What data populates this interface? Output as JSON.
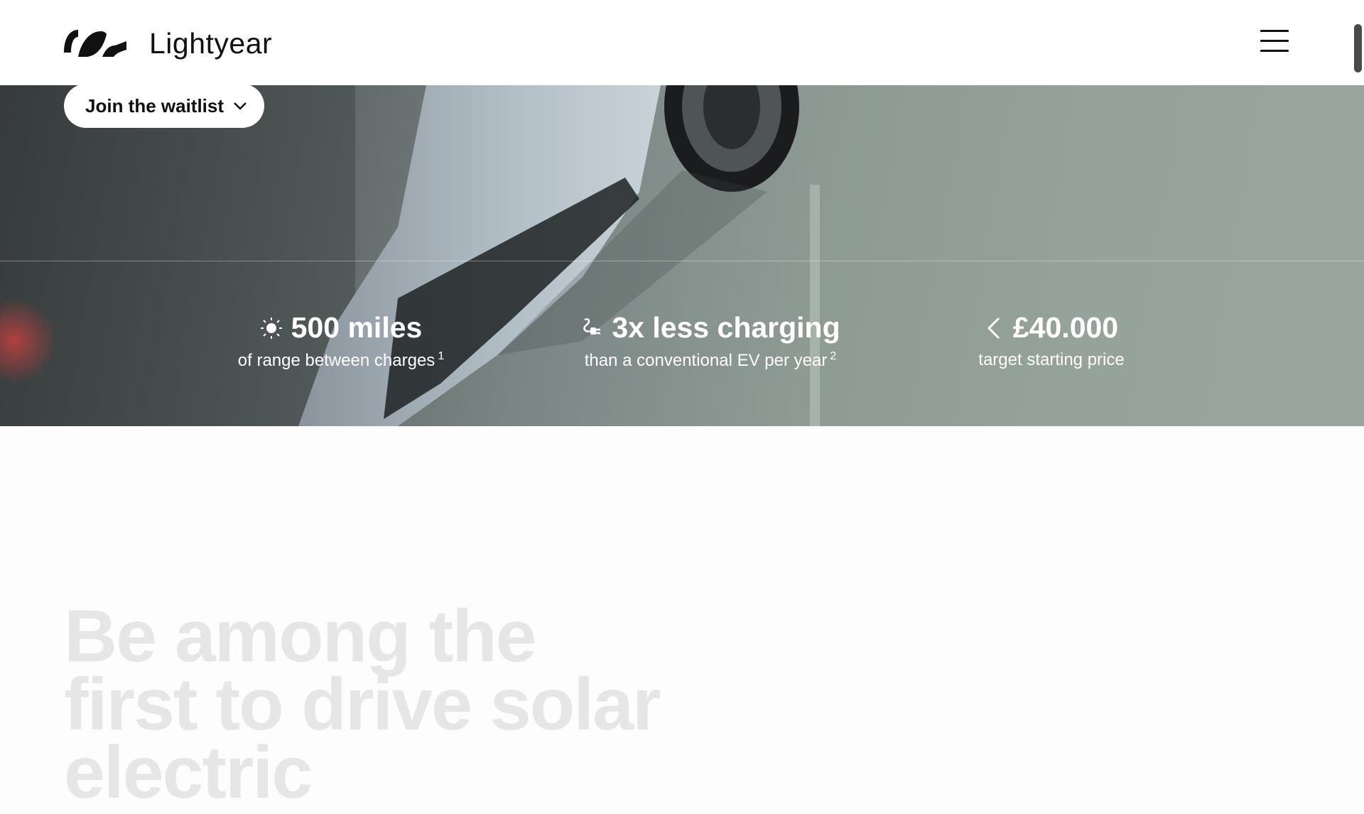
{
  "brand": {
    "name": "Lightyear",
    "logo_icon": "lightyear-logo-icon"
  },
  "header": {
    "menu_icon": "hamburger-menu-icon"
  },
  "hero": {
    "waitlist_button": "Join the waitlist",
    "waitlist_icon": "chevron-down-icon",
    "stats": [
      {
        "icon": "sun-icon",
        "value": "500 miles",
        "label": "of range between charges",
        "footnote": "1"
      },
      {
        "icon": "plug-icon",
        "value": "3x less charging",
        "label": "than a conventional EV per year",
        "footnote": "2"
      },
      {
        "icon": "less-than-icon",
        "value": "£40.000",
        "label": "target starting price",
        "footnote": ""
      }
    ]
  },
  "section": {
    "heading_lines": [
      "Be among the",
      "first to drive solar",
      "electric"
    ]
  },
  "colors": {
    "accent": "#111111",
    "hero_tint": "#8e9b95",
    "heading_faded": "#e6e6e6"
  }
}
